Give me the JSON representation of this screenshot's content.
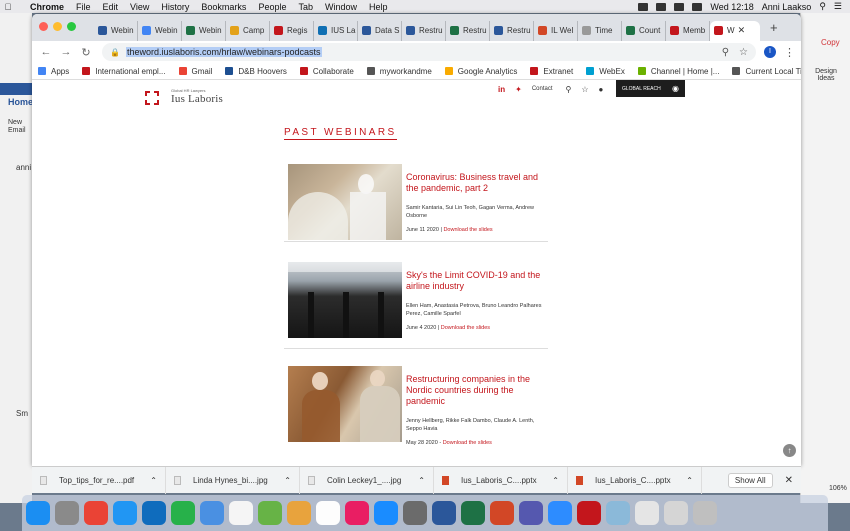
{
  "menubar": {
    "app": "Chrome",
    "items": [
      "File",
      "Edit",
      "View",
      "History",
      "Bookmarks",
      "People",
      "Tab",
      "Window",
      "Help"
    ],
    "clock": "Wed 12:18",
    "user": "Anni Laakso"
  },
  "tabs": [
    {
      "label": "Webin",
      "color": "#2b579a"
    },
    {
      "label": "Webin",
      "color": "#4285f4"
    },
    {
      "label": "Webin",
      "color": "#1e7145"
    },
    {
      "label": "Camp",
      "color": "#e3a21a"
    },
    {
      "label": "Regis",
      "color": "#c3161c"
    },
    {
      "label": "IUS La",
      "color": "#0f6fb3"
    },
    {
      "label": "Data S",
      "color": "#2b579a"
    },
    {
      "label": "Restru",
      "color": "#2b579a"
    },
    {
      "label": "Restru",
      "color": "#1e7145"
    },
    {
      "label": "Restru",
      "color": "#2b579a"
    },
    {
      "label": "IL Wel",
      "color": "#d24726"
    },
    {
      "label": "Time",
      "color": "#999999"
    },
    {
      "label": "Count",
      "color": "#1e7145"
    },
    {
      "label": "Memb",
      "color": "#c3161c"
    }
  ],
  "active_tab": {
    "label": "W",
    "color": "#c3161c"
  },
  "address": {
    "url": "theword.iuslaboris.com/hrlaw/webinars-podcasts"
  },
  "bookmarks": [
    {
      "label": "Apps",
      "color": "#4285f4"
    },
    {
      "label": "International empl...",
      "color": "#c3161c"
    },
    {
      "label": "Gmail",
      "color": "#ea4335"
    },
    {
      "label": "D&B Hoovers",
      "color": "#1d4f91"
    },
    {
      "label": "Collaborate",
      "color": "#c3161c"
    },
    {
      "label": "myworkandme",
      "color": "#555555"
    },
    {
      "label": "Google Analytics",
      "color": "#f9ab00"
    },
    {
      "label": "Extranet",
      "color": "#c3161c"
    },
    {
      "label": "WebEx",
      "color": "#00a0d1"
    },
    {
      "label": "Channel | Home |...",
      "color": "#6bb100"
    },
    {
      "label": "Current Local Tim...",
      "color": "#555555"
    }
  ],
  "site": {
    "tagline": "Global HR Lawyers",
    "brand": "Ius Laboris",
    "contact": "Contact",
    "global_reach": "GLOBAL REACH",
    "accent": "#c3161c"
  },
  "page_title": "PAST WEBINARS",
  "webinars": [
    {
      "title": "Coronavirus: Business travel and the pandemic, part 2",
      "speakers": "Samir Kantaria, Sui Lin Teoh, Gagan Verma, Andrew Osborne",
      "date": "June 11 2020",
      "link": "Download the slides"
    },
    {
      "title": "Sky's the Limit COVID-19 and the airline industry",
      "speakers": "Ellen Ham, Anastasia Petrova, Bruno Leandro Palhares Perez, Camille Sparfel",
      "date": "June 4 2020",
      "link": "Download the slides"
    },
    {
      "title": "Restructuring companies in the Nordic countries during the pandemic",
      "speakers": "Jenny Hellberg, Rikke Falk Dambo, Claude A. Lenth, Seppo Havia",
      "date": "May 28 2020",
      "link": "Download the slides"
    }
  ],
  "downloads": [
    {
      "name": "Top_tips_for_re....pdf",
      "type": "pdf"
    },
    {
      "name": "Linda Hynes_bi....jpg",
      "type": "img"
    },
    {
      "name": "Colin Leckey1_....jpg",
      "type": "img"
    },
    {
      "name": "Ius_Laboris_C....pptx",
      "type": "ppt"
    },
    {
      "name": "Ius_Laboris_C....pptx",
      "type": "ppt"
    }
  ],
  "downloads_show_all": "Show All",
  "bg_app": {
    "home": "Home",
    "new_email": "New Email",
    "design_ideas": "Design Ideas",
    "copy": "Copy",
    "zoom": "106%"
  },
  "dock_colors": [
    "#1b8ef2",
    "#8a8a8a",
    "#ea4335",
    "#2196f3",
    "#0f6cbd",
    "#27b14a",
    "#4a90e2",
    "#f5f5f5",
    "#67b346",
    "#e8a33d",
    "#fdfdfd",
    "#e91e63",
    "#1a8cff",
    "#6b6b6b",
    "#2b579a",
    "#1e7145",
    "#d24726",
    "#5558af",
    "#2d8cff",
    "#c3161c",
    "#8bb9d9",
    "#e5e5e5",
    "#d5d5d5",
    "#bfbfbf"
  ]
}
